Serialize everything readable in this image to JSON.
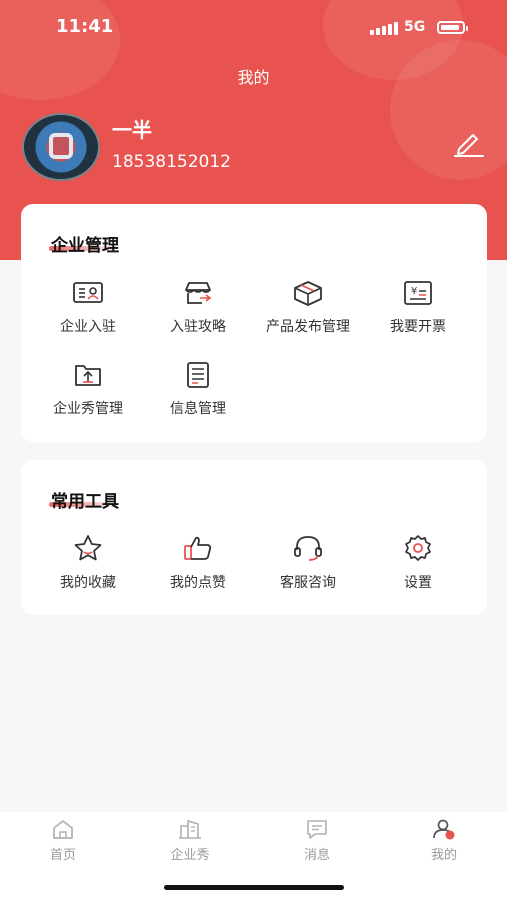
{
  "status_bar": {
    "time": "11:41",
    "network": "5G"
  },
  "header": {
    "title": "我的"
  },
  "profile": {
    "name": "一半",
    "phone": "18538152012"
  },
  "enterprise_section": {
    "title": "企业管理",
    "items": [
      {
        "label": "企业入驻",
        "icon": "id-card-icon"
      },
      {
        "label": "入驻攻略",
        "icon": "shop-icon"
      },
      {
        "label": "产品发布管理",
        "icon": "box-icon"
      },
      {
        "label": "我要开票",
        "icon": "invoice-icon"
      },
      {
        "label": "企业秀管理",
        "icon": "folder-upload-icon"
      },
      {
        "label": "信息管理",
        "icon": "document-icon"
      }
    ]
  },
  "tools_section": {
    "title": "常用工具",
    "items": [
      {
        "label": "我的收藏",
        "icon": "star-icon"
      },
      {
        "label": "我的点赞",
        "icon": "thumbs-up-icon"
      },
      {
        "label": "客服咨询",
        "icon": "headset-icon"
      },
      {
        "label": "设置",
        "icon": "gear-icon"
      }
    ]
  },
  "tabbar": {
    "tabs": [
      {
        "label": "首页",
        "icon": "home-icon"
      },
      {
        "label": "企业秀",
        "icon": "building-icon"
      },
      {
        "label": "消息",
        "icon": "message-icon"
      },
      {
        "label": "我的",
        "icon": "user-icon",
        "active": true
      }
    ]
  },
  "colors": {
    "accent": "#e8534f",
    "background": "#f7f7f7",
    "inactive": "#9a9a9a"
  }
}
